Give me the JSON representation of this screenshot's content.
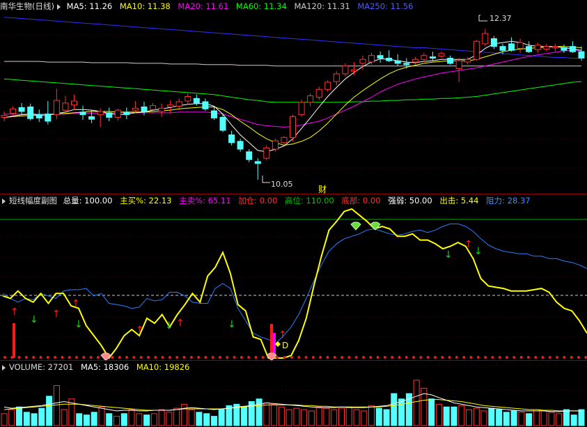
{
  "main_legend": {
    "title": "南华生物(日线)",
    "ma5": "MA5: 11.26",
    "ma10": "MA10: 11.38",
    "ma20": "MA20: 11.61",
    "ma60": "MA60: 11.34",
    "ma120": "MA120: 11.31",
    "ma250": "MA250: 11.56",
    "colors": {
      "ma5": "#ffffff",
      "ma10": "#ffff00",
      "ma20": "#ff00ff",
      "ma60": "#00ff00",
      "ma120": "#cccccc",
      "ma250": "#3030ff"
    }
  },
  "sub_legend": {
    "title": "短线幅度副图",
    "total": "总量: 100.00",
    "main_buy": "主买%: 22.13",
    "main_sell": "主卖%: 65.11",
    "add": "加仓: 0.00",
    "high": "高位: 110.00",
    "bottom": "底部: 0.00",
    "strength": "强弱: 50.00",
    "exit": "出击: 5.44",
    "resistance": "阻力: 28.37"
  },
  "vol_legend": {
    "volume": "VOLUME: 27201",
    "ma5": "MA5: 18306",
    "ma10": "MA10: 19826"
  },
  "annotations": {
    "high_price": "12.37",
    "low_price": "10.05",
    "finance_marker": "财",
    "d_marker": "D"
  },
  "chart_data": {
    "type": "candlestick",
    "price_range": [
      9.9,
      12.6
    ],
    "candles": [
      [
        11.01,
        11.1,
        10.95,
        11.04
      ],
      [
        11.07,
        11.18,
        11.02,
        11.14
      ],
      [
        11.16,
        11.23,
        11.06,
        11.1
      ],
      [
        11.17,
        11.22,
        10.96,
        10.99
      ],
      [
        11.05,
        11.13,
        10.94,
        11.0
      ],
      [
        11.06,
        11.26,
        10.9,
        10.95
      ],
      [
        11.05,
        11.45,
        10.98,
        11.27
      ],
      [
        11.12,
        11.34,
        11.08,
        11.23
      ],
      [
        11.2,
        11.36,
        11.12,
        11.26
      ],
      [
        11.09,
        11.19,
        10.97,
        11.05
      ],
      [
        11.02,
        11.12,
        10.92,
        10.98
      ],
      [
        11.05,
        11.15,
        10.86,
        11.1
      ],
      [
        11.08,
        11.16,
        10.95,
        11.01
      ],
      [
        11.01,
        11.14,
        10.96,
        11.12
      ],
      [
        11.09,
        11.16,
        10.98,
        11.05
      ],
      [
        11.12,
        11.26,
        11.08,
        11.15
      ],
      [
        11.17,
        11.25,
        11.04,
        11.1
      ],
      [
        11.13,
        11.23,
        11.08,
        11.19
      ],
      [
        11.1,
        11.22,
        11.02,
        11.15
      ],
      [
        11.17,
        11.27,
        11.07,
        11.2
      ],
      [
        11.18,
        11.3,
        11.12,
        11.25
      ],
      [
        11.26,
        11.38,
        11.2,
        11.33
      ],
      [
        11.3,
        11.36,
        11.19,
        11.23
      ],
      [
        11.25,
        11.3,
        11.11,
        11.14
      ],
      [
        11.11,
        11.17,
        10.97,
        11.0
      ],
      [
        11.01,
        11.06,
        10.78,
        10.81
      ],
      [
        10.74,
        10.8,
        10.58,
        10.62
      ],
      [
        10.64,
        10.68,
        10.48,
        10.52
      ],
      [
        10.48,
        10.52,
        10.32,
        10.36
      ],
      [
        10.33,
        10.38,
        10.05,
        10.3
      ],
      [
        10.38,
        10.58,
        10.35,
        10.54
      ],
      [
        10.52,
        10.68,
        10.48,
        10.65
      ],
      [
        10.62,
        10.72,
        10.58,
        10.7
      ],
      [
        10.7,
        11.05,
        10.64,
        11.02
      ],
      [
        11.05,
        11.28,
        11.02,
        11.24
      ],
      [
        11.24,
        11.38,
        11.18,
        11.34
      ],
      [
        11.32,
        11.48,
        11.28,
        11.44
      ],
      [
        11.44,
        11.58,
        11.4,
        11.55
      ],
      [
        11.56,
        11.72,
        11.5,
        11.68
      ],
      [
        11.68,
        11.84,
        11.64,
        11.8
      ],
      [
        11.72,
        11.86,
        11.66,
        11.74
      ],
      [
        11.84,
        11.96,
        11.74,
        11.9
      ],
      [
        11.86,
        12.0,
        11.82,
        11.96
      ],
      [
        11.96,
        12.02,
        11.85,
        11.92
      ],
      [
        11.92,
        12.04,
        11.86,
        11.88
      ],
      [
        11.88,
        11.98,
        11.8,
        11.84
      ],
      [
        11.84,
        11.92,
        11.76,
        11.82
      ],
      [
        11.86,
        11.94,
        11.82,
        11.9
      ],
      [
        11.9,
        12.0,
        11.86,
        11.96
      ],
      [
        11.94,
        12.02,
        11.88,
        11.92
      ],
      [
        11.95,
        12.02,
        11.92,
        11.99
      ],
      [
        11.92,
        11.96,
        11.82,
        11.84
      ],
      [
        11.76,
        11.92,
        11.55,
        11.88
      ],
      [
        11.86,
        11.94,
        11.82,
        11.9
      ],
      [
        11.9,
        12.2,
        11.88,
        12.18
      ],
      [
        12.14,
        12.37,
        12.1,
        12.3
      ],
      [
        12.22,
        12.26,
        12.06,
        12.1
      ],
      [
        12.1,
        12.14,
        11.98,
        12.04
      ],
      [
        12.14,
        12.24,
        12.02,
        12.04
      ],
      [
        12.07,
        12.22,
        12.0,
        12.16
      ],
      [
        12.1,
        12.18,
        12.0,
        12.02
      ],
      [
        12.05,
        12.16,
        12.0,
        12.12
      ],
      [
        12.06,
        12.14,
        12.03,
        12.1
      ],
      [
        12.08,
        12.14,
        12.02,
        12.1
      ],
      [
        12.08,
        12.13,
        12.0,
        12.04
      ],
      [
        12.1,
        12.18,
        12.0,
        12.02
      ],
      [
        12.02,
        12.1,
        11.88,
        11.92
      ]
    ],
    "ma5": [
      11.0,
      11.03,
      11.05,
      11.06,
      11.05,
      11.04,
      11.07,
      11.09,
      11.13,
      11.13,
      11.12,
      11.1,
      11.07,
      11.05,
      11.06,
      11.08,
      11.09,
      11.12,
      11.14,
      11.16,
      11.19,
      11.21,
      11.22,
      11.22,
      11.18,
      11.06,
      10.89,
      10.74,
      10.62,
      10.5,
      10.48,
      10.52,
      10.57,
      10.68,
      10.84,
      11.0,
      11.17,
      11.33,
      11.47,
      11.6,
      11.7,
      11.79,
      11.86,
      11.91,
      11.9,
      11.88,
      11.86,
      11.85,
      11.87,
      11.88,
      11.9,
      11.9,
      11.9,
      11.9,
      11.97,
      12.07,
      12.14,
      12.16,
      12.18,
      12.16,
      12.12,
      12.1,
      12.1,
      12.1,
      12.08,
      12.06,
      12.04
    ],
    "ma10": [
      11.01,
      11.02,
      11.03,
      11.04,
      11.04,
      11.05,
      11.06,
      11.07,
      11.08,
      11.09,
      11.1,
      11.1,
      11.1,
      11.09,
      11.09,
      11.09,
      11.09,
      11.1,
      11.11,
      11.12,
      11.14,
      11.15,
      11.16,
      11.17,
      11.17,
      11.13,
      11.05,
      10.95,
      10.86,
      10.76,
      10.68,
      10.62,
      10.58,
      10.6,
      10.64,
      10.7,
      10.8,
      10.92,
      11.06,
      11.2,
      11.32,
      11.42,
      11.51,
      11.6,
      11.68,
      11.74,
      11.78,
      11.81,
      11.84,
      11.86,
      11.87,
      11.88,
      11.88,
      11.88,
      11.9,
      11.94,
      11.98,
      12.02,
      12.04,
      12.06,
      12.07,
      12.08,
      12.09,
      12.1,
      12.1,
      12.09,
      12.08
    ],
    "ma20": [
      11.06,
      11.06,
      11.06,
      11.06,
      11.06,
      11.06,
      11.06,
      11.06,
      11.07,
      11.07,
      11.07,
      11.07,
      11.07,
      11.08,
      11.08,
      11.08,
      11.08,
      11.08,
      11.08,
      11.08,
      11.09,
      11.09,
      11.09,
      11.09,
      11.08,
      11.06,
      11.02,
      10.98,
      10.94,
      10.9,
      10.88,
      10.87,
      10.86,
      10.87,
      10.89,
      10.92,
      10.95,
      11.0,
      11.06,
      11.12,
      11.18,
      11.25,
      11.32,
      11.4,
      11.46,
      11.52,
      11.56,
      11.6,
      11.63,
      11.66,
      11.69,
      11.71,
      11.73,
      11.75,
      11.77,
      11.8,
      11.83,
      11.86,
      11.89,
      11.92,
      11.95,
      11.97,
      11.99,
      12.01,
      12.03,
      12.04,
      12.04
    ],
    "ma60": [
      11.6,
      11.59,
      11.58,
      11.57,
      11.56,
      11.55,
      11.54,
      11.53,
      11.52,
      11.51,
      11.5,
      11.49,
      11.48,
      11.47,
      11.46,
      11.45,
      11.44,
      11.43,
      11.42,
      11.41,
      11.4,
      11.39,
      11.38,
      11.37,
      11.36,
      11.34,
      11.32,
      11.3,
      11.28,
      11.27,
      11.25,
      11.24,
      11.24,
      11.24,
      11.24,
      11.24,
      11.24,
      11.24,
      11.24,
      11.24,
      11.25,
      11.25,
      11.26,
      11.26,
      11.27,
      11.27,
      11.28,
      11.28,
      11.29,
      11.29,
      11.3,
      11.3,
      11.31,
      11.32,
      11.33,
      11.35,
      11.37,
      11.39,
      11.41,
      11.43,
      11.45,
      11.47,
      11.49,
      11.51,
      11.53,
      11.55,
      11.56
    ],
    "ma120": [
      11.87,
      11.87,
      11.87,
      11.87,
      11.87,
      11.86,
      11.86,
      11.86,
      11.86,
      11.86,
      11.85,
      11.85,
      11.85,
      11.85,
      11.85,
      11.84,
      11.84,
      11.84,
      11.84,
      11.83,
      11.83,
      11.83,
      11.83,
      11.82,
      11.82,
      11.82,
      11.82,
      11.81,
      11.81,
      11.81,
      11.81,
      11.8,
      11.8,
      11.8,
      11.8,
      11.8,
      11.8,
      11.8,
      11.8,
      11.8,
      11.8,
      11.8,
      11.8,
      11.8,
      11.8,
      11.8,
      11.8,
      11.8,
      11.8,
      11.8,
      11.8,
      11.8,
      11.8,
      11.8,
      11.8,
      11.8,
      11.8,
      11.8,
      11.8,
      11.8,
      11.8,
      11.8,
      11.8,
      11.8,
      11.8,
      11.8,
      11.8
    ],
    "ma250": [
      12.55,
      12.54,
      12.53,
      12.52,
      12.51,
      12.5,
      12.49,
      12.48,
      12.47,
      12.46,
      12.45,
      12.44,
      12.43,
      12.42,
      12.41,
      12.4,
      12.39,
      12.38,
      12.37,
      12.36,
      12.35,
      12.34,
      12.33,
      12.32,
      12.31,
      12.3,
      12.29,
      12.28,
      12.27,
      12.26,
      12.25,
      12.24,
      12.23,
      12.22,
      12.21,
      12.2,
      12.19,
      12.18,
      12.17,
      12.16,
      12.15,
      12.14,
      12.13,
      12.12,
      12.11,
      12.1,
      12.09,
      12.08,
      12.08,
      12.07,
      12.06,
      12.05,
      12.04,
      12.03,
      12.02,
      12.01,
      12.0,
      11.99,
      11.98,
      11.97,
      11.96,
      11.95,
      11.94,
      11.93,
      11.93,
      11.92,
      11.92
    ],
    "sub_range": [
      0,
      120
    ],
    "sub_ref_lines": [
      110,
      50
    ],
    "short_line": [
      50,
      48,
      54,
      48,
      45,
      52,
      44,
      52,
      52,
      42,
      40,
      26,
      18,
      10,
      0,
      8,
      18,
      23,
      18,
      32,
      28,
      35,
      25,
      35,
      43,
      52,
      45,
      66,
      73,
      85,
      68,
      43,
      38,
      17,
      15,
      0,
      0,
      0,
      2,
      14,
      32,
      58,
      82,
      103,
      110,
      118,
      120,
      115,
      110,
      104,
      106,
      104,
      98,
      98,
      100,
      95,
      95,
      92,
      88,
      90,
      93,
      90,
      80,
      64,
      58,
      57,
      56,
      54,
      54,
      54,
      55,
      56,
      53,
      45,
      40,
      38,
      30,
      20
    ],
    "strength_line": [
      52,
      48,
      45,
      48,
      47,
      52,
      50,
      48,
      54,
      55,
      55,
      56,
      50,
      52,
      44,
      43,
      42,
      40,
      41,
      48,
      46,
      47,
      53,
      53,
      50,
      45,
      44,
      44,
      56,
      60,
      56,
      40,
      30,
      20,
      17,
      15,
      12,
      18,
      25,
      35,
      48,
      62,
      75,
      86,
      92,
      96,
      98,
      100,
      103,
      104,
      102,
      100,
      99,
      100,
      102,
      103,
      101,
      103,
      106,
      108,
      108,
      106,
      102,
      96,
      91,
      88,
      86,
      85,
      84,
      84,
      82,
      82,
      80,
      80,
      78,
      77,
      75,
      72
    ],
    "volume": [
      9000,
      12000,
      14000,
      10000,
      9000,
      13000,
      22000,
      30000,
      12000,
      20000,
      9000,
      8000,
      10000,
      14000,
      9000,
      7000,
      9000,
      12000,
      9000,
      8000,
      9000,
      12000,
      10000,
      13000,
      16000,
      12000,
      10000,
      9000,
      7000,
      12000,
      15000,
      16000,
      14000,
      18000,
      20000,
      17000,
      16000,
      14000,
      12000,
      13000,
      12000,
      11000,
      14000,
      13000,
      12000,
      13000,
      14000,
      12000,
      11000,
      15000,
      13000,
      12000,
      24000,
      20000,
      24000,
      34000,
      28000,
      20000,
      16000,
      14000,
      14000,
      15000,
      12000,
      13000,
      11000,
      13000,
      12000,
      10000,
      11000,
      10000,
      9000,
      12000,
      11000,
      10000,
      9000,
      12000,
      8000,
      12000
    ],
    "volume_ma5": [
      14000,
      13000,
      13500,
      14000,
      14500,
      15000,
      16000,
      17000,
      18000,
      17000,
      16000,
      15000,
      14000,
      13000,
      12000,
      11000,
      11500,
      11500,
      11000,
      11000,
      11500,
      11500,
      11500,
      12000,
      13000,
      13500,
      13000,
      12500,
      12000,
      12500,
      13000,
      14000,
      14500,
      15000,
      16000,
      17000,
      16500,
      16000,
      15500,
      15000,
      14500,
      14000,
      13500,
      13500,
      13500,
      14000,
      13500,
      13500,
      13500,
      14000,
      14500,
      15000,
      16500,
      18000,
      20000,
      22000,
      24000,
      23000,
      21000,
      19000,
      17000,
      16000,
      15000,
      14000,
      13500,
      13000,
      12500,
      12000,
      11500,
      11000,
      11000,
      11000,
      11000,
      10500,
      10500,
      11000,
      11000,
      11000
    ],
    "volume_ma10": [
      12000,
      12500,
      13000,
      13500,
      14000,
      14500,
      15000,
      15500,
      16000,
      16000,
      16000,
      15500,
      15000,
      14500,
      14000,
      13500,
      13000,
      12500,
      12000,
      11500,
      11500,
      11500,
      11500,
      12000,
      12500,
      12500,
      12500,
      12500,
      12500,
      12500,
      13000,
      13500,
      14000,
      14500,
      15000,
      15500,
      15500,
      15500,
      15500,
      15500,
      15000,
      15000,
      14500,
      14500,
      14000,
      14000,
      14000,
      14000,
      14000,
      14000,
      14000,
      14500,
      15000,
      16000,
      17000,
      18000,
      19000,
      19500,
      19500,
      19000,
      18500,
      18000,
      17000,
      16000,
      15000,
      14500,
      14000,
      13500,
      13000,
      12500,
      12000,
      12000,
      11500,
      11500,
      11000,
      11000,
      11000,
      11000
    ]
  }
}
